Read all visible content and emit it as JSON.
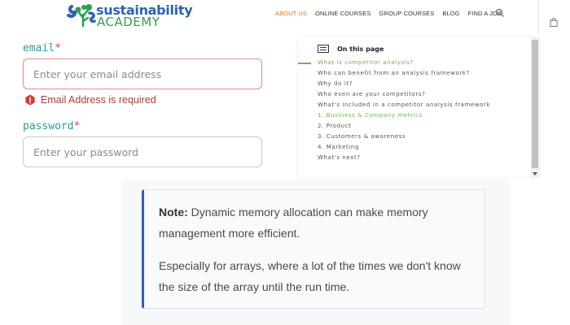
{
  "header": {
    "logo": {
      "line1": "sustainability",
      "line2": "ACADEMY"
    },
    "nav": [
      {
        "label": "ABOUT US",
        "active": true
      },
      {
        "label": "ONLINE COURSES",
        "active": false
      },
      {
        "label": "GROUP COURSES",
        "active": false
      },
      {
        "label": "BLOG",
        "active": false
      },
      {
        "label": "FIND A JOB",
        "active": false
      }
    ],
    "icons": {
      "search": "search-icon",
      "cart": "shopping-bag-icon"
    },
    "accent_color": "#e3731b"
  },
  "form": {
    "email": {
      "label": "email",
      "required_mark": "*",
      "placeholder": "Enter your email address",
      "error": "Email Address is required"
    },
    "password": {
      "label": "password",
      "required_mark": "*",
      "placeholder": "Enter your password"
    },
    "error_color": "#b33a3a",
    "label_color": "#2a9a9e"
  },
  "toc": {
    "title": "On this page",
    "items": [
      {
        "label": "What is competitor analysis?",
        "state": "active"
      },
      {
        "label": "Who can benefit from an analysis framework?",
        "state": ""
      },
      {
        "label": "Why do it?",
        "state": ""
      },
      {
        "label": "Who even are your competitors?",
        "state": ""
      },
      {
        "label": "What's included in a competitor analysis framework",
        "state": ""
      },
      {
        "label": "1. Business & Company metrics",
        "state": "active"
      },
      {
        "label": "2. Product",
        "state": ""
      },
      {
        "label": "3. Customers & awareness",
        "state": ""
      },
      {
        "label": "4. Marketing",
        "state": ""
      },
      {
        "label": "What's next?",
        "state": ""
      }
    ],
    "accent_color": "#6fb34a"
  },
  "note": {
    "label": "Note:",
    "line1": "Dynamic memory allocation can make memory management more efficient.",
    "line2": "Especially for arrays, where a lot of the times we don't know the size of the array until the run time.",
    "accent_color": "#2f5fbf"
  }
}
